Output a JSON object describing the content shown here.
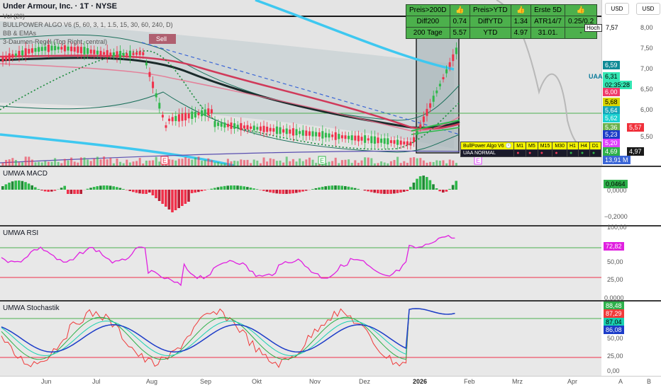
{
  "main": {
    "title": "Under Armour, Inc. · 1T · NYSE",
    "indicators": [
      "Vol (20)",
      "BULLPOWER ALGO V6 (5, 60, 3, 1, 1.5, 15, 30, 60, 240, D)",
      "BB & EMAs",
      "3-Daumen-Regel (Top Right, central)"
    ],
    "sell_tag": "Sell",
    "earnings_marker": "E"
  },
  "currency_buttons": [
    "USD",
    "USD"
  ],
  "price_axis": [
    "8,00",
    "7,50",
    "7,00",
    "6,50",
    "6,00",
    "5,50"
  ],
  "hoch": {
    "label": "Hoch",
    "value": "7,57"
  },
  "symbol_tag": "UAA",
  "price_labels": [
    {
      "text": "6,59",
      "color": "#0f8a96"
    },
    {
      "text": "6,31",
      "color": "#33e6b3"
    },
    {
      "text": "02:35:28",
      "color": "#33e6b3"
    },
    {
      "text": "6,00",
      "color": "#f03a6a"
    },
    {
      "text": "5,68",
      "color": "#d8d400"
    },
    {
      "text": "5,64",
      "color": "#14a6b8"
    },
    {
      "text": "5,62",
      "color": "#1ad0d0"
    },
    {
      "text": "5,57",
      "color": "#f0303a"
    },
    {
      "text": "5,36",
      "color": "#6ab04c"
    },
    {
      "text": "5,23",
      "color": "#1c3cc8"
    },
    {
      "text": "5,20",
      "color": "#e040fb"
    },
    {
      "text": "4,97",
      "color": "#1a1a1a"
    },
    {
      "text": "4,69",
      "color": "#2db04a"
    },
    {
      "text": "13,91 M",
      "color": "#3b66d6"
    }
  ],
  "table": {
    "header": [
      "Preis>200D",
      "👍",
      "Preis>YTD",
      "👍",
      "Erste 5D",
      "👍"
    ],
    "row1": [
      "Diff200",
      "0.74",
      "DiffYTD",
      "1.34",
      "ATR14/7",
      "0.25/0.2"
    ],
    "row2": [
      "200 Tage",
      "5.57",
      "YTD",
      "4.97",
      "31.01.",
      "-"
    ]
  },
  "mtf": {
    "title": "BullPower Algo V6 🕐",
    "timeframes": [
      "M1",
      "M5",
      "M15",
      "M30",
      "H1",
      "H4",
      "D1"
    ],
    "row_label": "UAA   NORMAL"
  },
  "macd": {
    "title": "UMWA MACD",
    "value": "0,0464",
    "ticks": [
      "0,0000",
      "−0,2000"
    ]
  },
  "rsi": {
    "title": "UMWA RSI",
    "value": "72,82",
    "ticks": [
      "100,00",
      "50,00",
      "25,00",
      "0,0000"
    ]
  },
  "stoch": {
    "title": "UMWA Stochastik",
    "labels": [
      {
        "text": "88,48",
        "color": "#2db04a"
      },
      {
        "text": "87,29",
        "color": "#f03a3a"
      },
      {
        "text": "87,04",
        "color": "#1ad0b0"
      },
      {
        "text": "86,08",
        "color": "#1c3cc8"
      }
    ],
    "ticks": [
      "50,00",
      "25,00",
      "0,00"
    ]
  },
  "x_axis": [
    "Jun",
    "Jul",
    "Aug",
    "Sep",
    "Okt",
    "Nov",
    "Dez",
    "2026",
    "Feb",
    "Mrz",
    "Apr"
  ],
  "corner": [
    "A",
    "B"
  ],
  "colors": {
    "bull": "#2fb84a",
    "bear": "#f0304a",
    "rsi": "#e020e0",
    "cyan": "#3ec8f0",
    "green": "#4caf50"
  }
}
